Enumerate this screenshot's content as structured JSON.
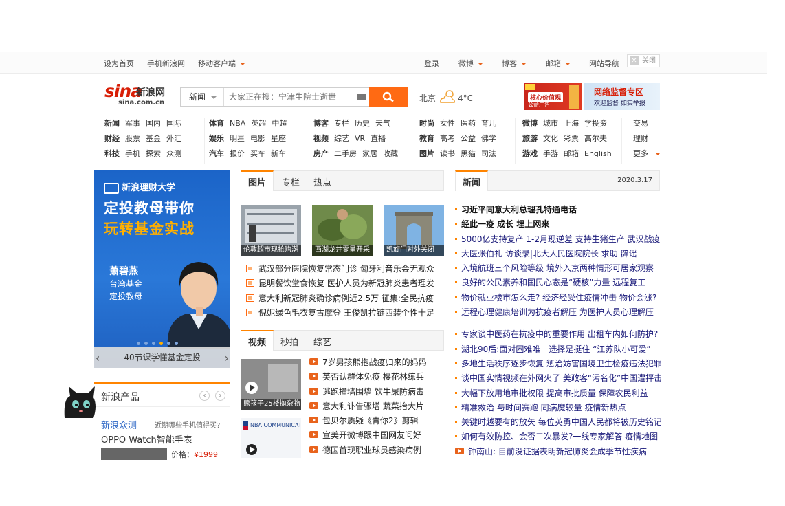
{
  "topbar": {
    "set_home": "设为首页",
    "mobile_sina": "手机新浪网",
    "mobile_client": "移动客户端",
    "login": "登录",
    "weibo": "微博",
    "blog": "博客",
    "mail": "邮箱",
    "site_nav": "网站导航",
    "close": "关闭"
  },
  "header": {
    "logo_text": "sina",
    "logo_cn": "新浪网",
    "logo_domain": "sina.com.cn",
    "search_category": "新闻",
    "search_placeholder": "大家正在搜：宁津生院士逝世",
    "city": "北京",
    "temperature": "4°C",
    "ad_left_text": "核心价值观",
    "ad_left_sub": "公益广告",
    "ad_right_title": "网络监督专区",
    "ad_right_sub": "欢迎监督 如实举报"
  },
  "nav": {
    "groups": [
      [
        [
          "新闻",
          "军事",
          "国内",
          "国际"
        ],
        [
          "财经",
          "股票",
          "基金",
          "外汇"
        ],
        [
          "科技",
          "手机",
          "探索",
          "众测"
        ]
      ],
      [
        [
          "体育",
          "NBA",
          "英超",
          "中超"
        ],
        [
          "娱乐",
          "明星",
          "电影",
          "星座"
        ],
        [
          "汽车",
          "报价",
          "买车",
          "新车"
        ]
      ],
      [
        [
          "博客",
          "专栏",
          "历史",
          "天气"
        ],
        [
          "视频",
          "综艺",
          "VR",
          "直播"
        ],
        [
          "房产",
          "二手房",
          "家居",
          "收藏"
        ]
      ],
      [
        [
          "时尚",
          "女性",
          "医药",
          "育儿"
        ],
        [
          "教育",
          "高考",
          "公益",
          "佛学"
        ],
        [
          "图片",
          "读书",
          "黑猫",
          "司法"
        ]
      ],
      [
        [
          "微博",
          "城市",
          "上海",
          "学投资"
        ],
        [
          "旅游",
          "文化",
          "彩票",
          "高尔夫"
        ],
        [
          "游戏",
          "手游",
          "邮箱",
          "English"
        ]
      ],
      [
        [
          "交易"
        ],
        [
          "理财"
        ],
        [
          "更多"
        ]
      ]
    ]
  },
  "left_ad": {
    "brand": "新浪理财大学",
    "headline1": "定投教母带你",
    "headline2": "玩转基金实战",
    "person_name": "萧碧燕",
    "person_title1": "台湾基金",
    "person_title2": "定投教母",
    "caption": "40节课学懂基金定投"
  },
  "products": {
    "title": "新浪产品",
    "zhongce": "新浪众测",
    "zhongce_sub": "近期哪些手机值得买?",
    "product_name": "OPPO Watch智能手表",
    "price_label": "价格：",
    "price_value": "¥1999"
  },
  "photo_section": {
    "tabs": [
      "图片",
      "专栏",
      "热点"
    ],
    "photos": [
      {
        "caption": "伦敦超市现抢购潮"
      },
      {
        "caption": "西湖龙井零星开采"
      },
      {
        "caption": "凯旋门对外关闭"
      }
    ],
    "items": [
      "武汉部分医院恢复常态门诊 匈牙利音乐会无观众",
      "昆明餐饮堂食恢复 医护人员为新冠肺炎患者理发",
      "意大利新冠肺炎确诊病例近2.5万 征集:全民抗疫",
      "倪妮绿色毛衣复古摩登 王俊凯拉链西装个性十足"
    ]
  },
  "video_section": {
    "tabs": [
      "视频",
      "秒拍",
      "综艺"
    ],
    "thumb1_caption": "熊孩子25楼抛杂物",
    "thumb2_caption": "NBA COMMUNICATIONS",
    "items": [
      "7岁男孩熊抱战疫归来的妈妈",
      "英否认群体免疫 樱花林练兵",
      "逃跑撞墙围墙 饮牛尿防病毒",
      "意大利讣告骤增 蔬菜抬大片",
      "包贝尔质疑《青你2》剪辑",
      "宣美开微博跟中国网友问好",
      "德国首现职业球员感染病例"
    ]
  },
  "news": {
    "tab": "新闻",
    "date": "2020.3.17",
    "items": [
      {
        "text": "习近平同意大利总理孔特通电话",
        "bold": true
      },
      {
        "text": "经此一疫 成长 埋上网来",
        "bold": true
      },
      {
        "text": "5000亿支持复产 1-2月现逆差 支持生猪生产 武汉战疫",
        "bold": false
      },
      {
        "text": "大医张伯礼 访谈录|北大人民医院院长 求助 辟谣",
        "bold": false
      },
      {
        "text": "入境航班三个风险等级 境外入京两种情形可居家观察",
        "bold": false
      },
      {
        "text": "良好的公民素养和国民心态是“硬核”力量 远程复工",
        "bold": false
      },
      {
        "text": "物价就业楼市怎么走? 经济经受住疫情冲击 物价会涨?",
        "bold": false
      },
      {
        "text": "远程心理健康培训为抗疫者解压 为医护人员心理解压",
        "bold": false
      },
      {
        "text": "专家谈中医药在抗疫中的重要作用 出租车内如何防护?",
        "bold": false
      },
      {
        "text": "湖北90后:面对困难唯一选择是挺住 “江苏队小可爱”",
        "bold": false
      },
      {
        "text": "多地生活秩序逐步恢复 惩治妨害国境卫生检疫违法犯罪",
        "bold": false
      },
      {
        "text": "谈中国实情视频在外网火了 美政客“污名化”中国遭抨击",
        "bold": false
      },
      {
        "text": "大幅下放用地审批权限 提高审批质量 保障农民利益",
        "bold": false
      },
      {
        "text": "精准救治 与时间赛跑 同病魔较量 疫情新热点",
        "bold": false
      },
      {
        "text": "关键时越要有的放矢 每位英勇中国人民都将被历史铭记",
        "bold": false
      },
      {
        "text": "如何有效防控、会否二次暴发?一线专家解答 疫情地图",
        "bold": false
      },
      {
        "text": "钟南山: 目前没证据表明新冠肺炎会成季节性疾病",
        "bold": false
      }
    ]
  },
  "colors": {
    "brand_orange": "#ff8400",
    "search_button": "#ff6a13",
    "logo_red": "#d81e06",
    "link_blue": "#1a1a7a"
  }
}
